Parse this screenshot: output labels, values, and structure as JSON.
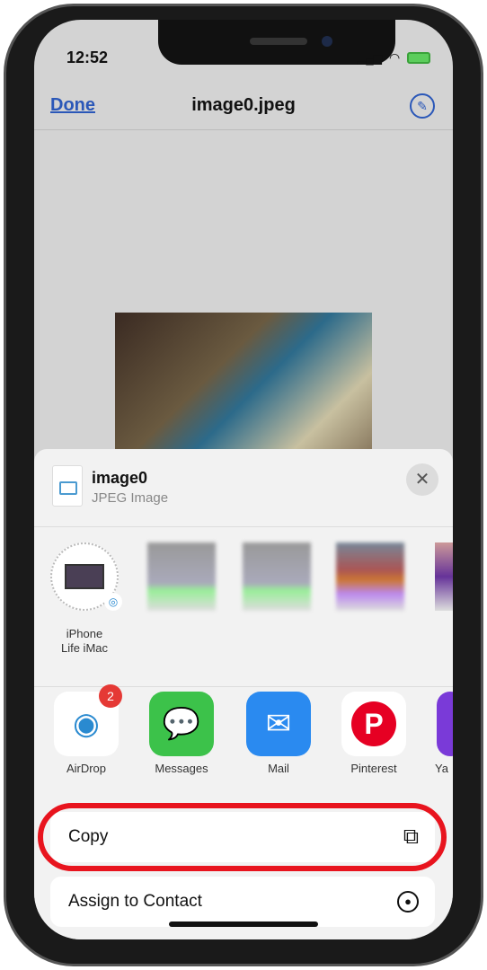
{
  "status_bar": {
    "time": "12:52"
  },
  "nav": {
    "done_label": "Done",
    "title": "image0.jpeg",
    "markup_icon": "markup-pen-icon"
  },
  "share_sheet": {
    "file_name": "image0",
    "file_type": "JPEG Image",
    "people": [
      {
        "label_line1": "iPhone",
        "label_line2": "Life iMac"
      },
      {
        "label_line1": "",
        "label_line2": ""
      },
      {
        "label_line1": "",
        "label_line2": ""
      },
      {
        "label_line1": "",
        "label_line2": ""
      }
    ],
    "apps": [
      {
        "label": "AirDrop",
        "badge": "2"
      },
      {
        "label": "Messages"
      },
      {
        "label": "Mail"
      },
      {
        "label": "Pinterest"
      },
      {
        "label": "Ya"
      }
    ],
    "actions": [
      {
        "label": "Copy",
        "icon": "copy-icon"
      },
      {
        "label": "Assign to Contact",
        "icon": "person-circle-icon"
      }
    ]
  },
  "colors": {
    "accent": "#2a57b8",
    "highlight": "#e8141e"
  }
}
